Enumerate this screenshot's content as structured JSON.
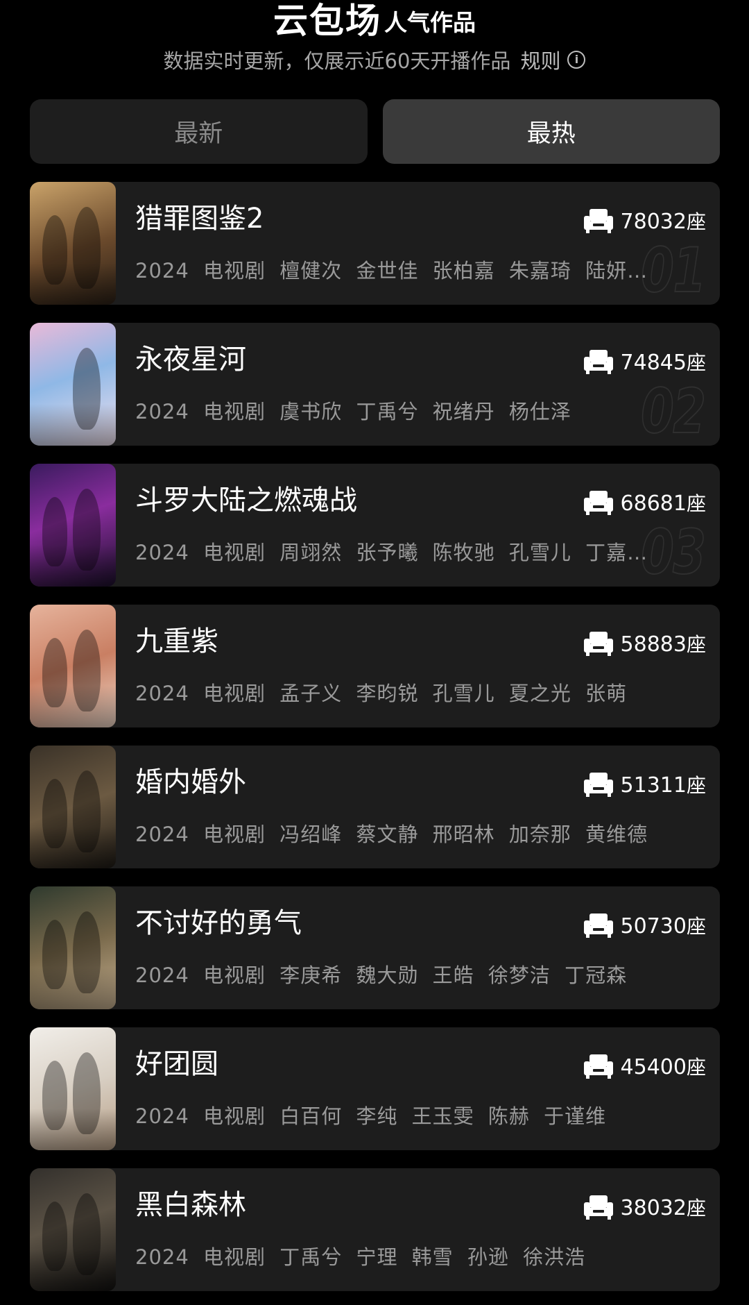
{
  "header": {
    "title_main": "云包场",
    "title_suffix": "人气作品",
    "subtitle": "数据实时更新，仅展示近60天开播作品",
    "rule_label": "规则"
  },
  "tabs": [
    {
      "label": "最新",
      "active": false
    },
    {
      "label": "最热",
      "active": true
    }
  ],
  "items": [
    {
      "rank": "01",
      "title": "猎罪图鉴2",
      "meta": "2024  电视剧  檀健次  金世佳  张柏嘉  朱嘉琦  陆妍…",
      "seats": "78032",
      "unit": "座"
    },
    {
      "rank": "02",
      "title": "永夜星河",
      "meta": "2024  电视剧  虞书欣  丁禹兮  祝绪丹  杨仕泽",
      "seats": "74845",
      "unit": "座"
    },
    {
      "rank": "03",
      "title": "斗罗大陆之燃魂战",
      "meta": "2024  电视剧  周翊然  张予曦  陈牧驰  孔雪儿  丁嘉…",
      "seats": "68681",
      "unit": "座"
    },
    {
      "rank": "",
      "title": "九重紫",
      "meta": "2024  电视剧  孟子义  李昀锐  孔雪儿  夏之光  张萌",
      "seats": "58883",
      "unit": "座"
    },
    {
      "rank": "",
      "title": "婚内婚外",
      "meta": "2024  电视剧  冯绍峰  蔡文静  邢昭林  加奈那  黄维德",
      "seats": "51311",
      "unit": "座"
    },
    {
      "rank": "",
      "title": "不讨好的勇气",
      "meta": "2024  电视剧  李庚希  魏大勋  王皓  徐梦洁  丁冠森",
      "seats": "50730",
      "unit": "座"
    },
    {
      "rank": "",
      "title": "好团圆",
      "meta": "2024  电视剧  白百何  李纯  王玉雯  陈赫  于谨维",
      "seats": "45400",
      "unit": "座"
    },
    {
      "rank": "",
      "title": "黑白森林",
      "meta": "2024  电视剧  丁禹兮  宁理  韩雪  孙逊  徐洪浩",
      "seats": "38032",
      "unit": "座"
    }
  ]
}
